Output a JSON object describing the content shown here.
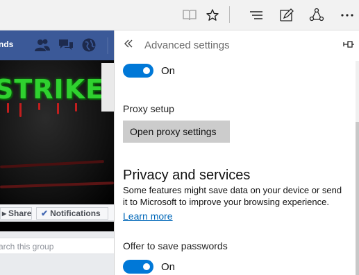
{
  "toolbar": {
    "icons": [
      "reading-view-icon",
      "favorite-star-icon",
      "hub-icon",
      "web-note-icon",
      "share-icon",
      "more-icon"
    ]
  },
  "facebook": {
    "bar_text": "nds",
    "cover_text": "STRIKE",
    "share_label": "Share",
    "notifications_label": "Notifications",
    "search_placeholder": "arch this group",
    "brand_color": "#3b5998"
  },
  "panel": {
    "title": "Advanced settings",
    "top_toggle": {
      "state_label": "On",
      "on": true
    },
    "proxy": {
      "label": "Proxy setup",
      "button_label": "Open proxy settings"
    },
    "privacy": {
      "heading": "Privacy and services",
      "description": "Some features might save data on your device or send it to Microsoft to improve your browsing experience.",
      "learn_more": "Learn more"
    },
    "passwords": {
      "label": "Offer to save passwords",
      "state_label": "On",
      "on": true
    }
  },
  "colors": {
    "accent": "#0078d7",
    "link": "#0067b8",
    "button_gray": "#cccccc"
  }
}
